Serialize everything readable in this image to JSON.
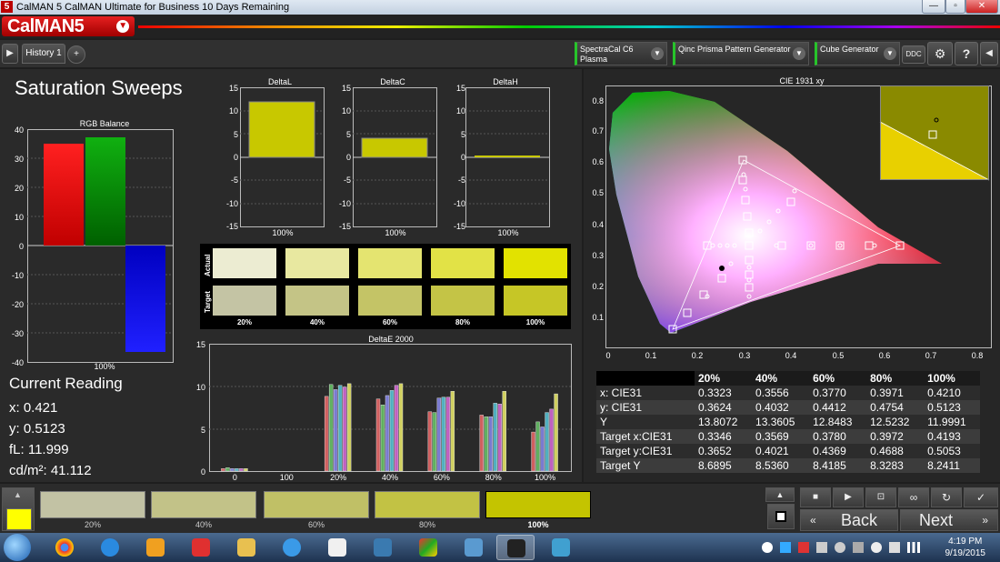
{
  "window": {
    "title": "CalMAN 5 CalMAN Ultimate for Business 10 Days Remaining",
    "minimize": "—",
    "maximize": "▫",
    "close": "✕"
  },
  "logo": {
    "text": "CalMAN5"
  },
  "toolbar": {
    "history_tab": "History 1",
    "add_tab": "+",
    "meter": {
      "line1": "SpectraCal C6",
      "line2": "Plasma"
    },
    "pattern_generator": "Qinc Prisma Pattern Generator",
    "cube_generator": "Cube Generator",
    "ddc": "DDC"
  },
  "page_title": "Saturation Sweeps",
  "rgb_balance": {
    "title": "RGB Balance",
    "y_ticks": [
      "40",
      "30",
      "20",
      "10",
      "0",
      "-10",
      "-20",
      "-30",
      "-40"
    ],
    "x_label": "100%",
    "colors": {
      "red": "#ff0000",
      "green": "#00a000",
      "blue": "#0000ff"
    }
  },
  "delta_l": {
    "title": "DeltaL",
    "x_label": "100%"
  },
  "delta_c": {
    "title": "DeltaC",
    "x_label": "100%"
  },
  "delta_h": {
    "title": "DeltaH",
    "x_label": "100%"
  },
  "delta_ticks": [
    "15",
    "10",
    "5",
    "0",
    "-5",
    "-10",
    "-15"
  ],
  "swatches": {
    "actual_label": "Actual",
    "target_label": "Target",
    "labels": [
      "20%",
      "40%",
      "60%",
      "80%",
      "100%"
    ],
    "actual_colors": [
      "#ececd2",
      "#e8e8a0",
      "#e4e470",
      "#e2e246",
      "#e2e200"
    ],
    "target_colors": [
      "#c4c4a4",
      "#c4c486",
      "#c4c466",
      "#c4c446",
      "#c6c626"
    ]
  },
  "deltae_chart": {
    "title": "DeltaE 2000",
    "y_ticks": [
      "15",
      "10",
      "5",
      "0"
    ],
    "x_labels": [
      "0",
      "100",
      "20%",
      "40%",
      "60%",
      "80%",
      "100%"
    ]
  },
  "chart_data": {
    "type": "bar",
    "title": "DeltaE 2000",
    "categories": [
      "0",
      "100",
      "20%",
      "40%",
      "60%",
      "80%",
      "100%"
    ],
    "series": [
      {
        "name": "",
        "values": [
          0.3,
          0,
          8.8,
          8.5,
          7.0,
          6.6,
          4.6
        ]
      },
      {
        "name": "",
        "values": [
          0.4,
          0,
          10.2,
          7.8,
          6.9,
          6.4,
          5.8
        ]
      },
      {
        "name": "",
        "values": [
          0.3,
          0,
          9.6,
          8.9,
          8.6,
          6.4,
          5.2
        ]
      },
      {
        "name": "",
        "values": [
          0.3,
          0,
          10.1,
          9.5,
          8.7,
          8.0,
          6.9
        ]
      },
      {
        "name": "",
        "values": [
          0.3,
          0,
          9.9,
          10.1,
          8.7,
          7.9,
          7.3
        ]
      },
      {
        "name": "",
        "values": [
          0.3,
          0,
          10.3,
          10.3,
          9.4,
          9.4,
          9.1
        ]
      }
    ],
    "ylim": [
      0,
      15
    ]
  },
  "current_reading": {
    "title": "Current Reading",
    "x": "x: 0.421",
    "y": "y: 0.5123",
    "fl": "fL: 11.999",
    "cdm2": "cd/m²: 41.112",
    "color": "#ffff00"
  },
  "cie": {
    "title": "CIE 1931 xy",
    "x_ticks": [
      "0",
      "0.1",
      "0.2",
      "0.3",
      "0.4",
      "0.5",
      "0.6",
      "0.7",
      "0.8"
    ],
    "y_ticks": [
      "0.8",
      "0.7",
      "0.6",
      "0.5",
      "0.4",
      "0.3",
      "0.2",
      "0.1"
    ]
  },
  "table": {
    "header": [
      "",
      "20%",
      "40%",
      "60%",
      "80%",
      "100%"
    ],
    "rows": [
      [
        "x: CIE31",
        "0.3323",
        "0.3556",
        "0.3770",
        "0.3971",
        "0.4210"
      ],
      [
        "y: CIE31",
        "0.3624",
        "0.4032",
        "0.4412",
        "0.4754",
        "0.5123"
      ],
      [
        "Y",
        "13.8072",
        "13.3605",
        "12.8483",
        "12.5232",
        "11.9991"
      ],
      [
        "Target x:CIE31",
        "0.3346",
        "0.3569",
        "0.3780",
        "0.3972",
        "0.4193"
      ],
      [
        "Target y:CIE31",
        "0.3652",
        "0.4021",
        "0.4369",
        "0.4688",
        "0.5053"
      ],
      [
        "Target Y",
        "8.6895",
        "8.5360",
        "8.4185",
        "8.3283",
        "8.2411"
      ]
    ]
  },
  "bottom": {
    "swatches": [
      {
        "label": "20%",
        "color": "#c2c2a4"
      },
      {
        "label": "40%",
        "color": "#c2c288"
      },
      {
        "label": "60%",
        "color": "#c0c066"
      },
      {
        "label": "80%",
        "color": "#c2c244"
      },
      {
        "label": "100%",
        "color": "#c4c400"
      }
    ],
    "back": "Back",
    "next": "Next"
  },
  "taskbar": {
    "time": "4:19 PM",
    "date": "9/19/2015"
  }
}
